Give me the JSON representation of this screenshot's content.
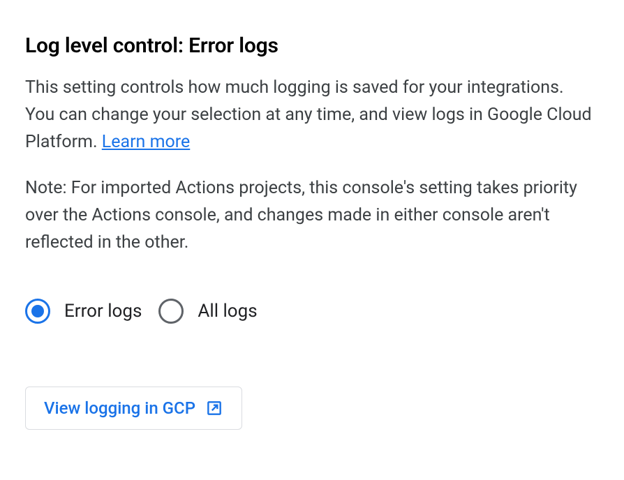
{
  "heading": "Log level control: Error logs",
  "description": {
    "text_before_link": "This setting controls how much logging is saved for your integrations. You can change your selection at any time, and view logs in Google Cloud Platform. ",
    "link_text": "Learn more"
  },
  "note": "Note: For imported Actions projects, this console's setting takes priority over the Actions console, and changes made in either console aren't reflected in the other.",
  "radio_options": {
    "error_logs": {
      "label": "Error logs",
      "selected": true
    },
    "all_logs": {
      "label": "All logs",
      "selected": false
    }
  },
  "button": {
    "label": "View logging in GCP"
  },
  "colors": {
    "link": "#1a73e8",
    "text": "#3c4043",
    "heading": "#000000",
    "border": "#dadce0",
    "radio_unselected": "#5f6368"
  }
}
